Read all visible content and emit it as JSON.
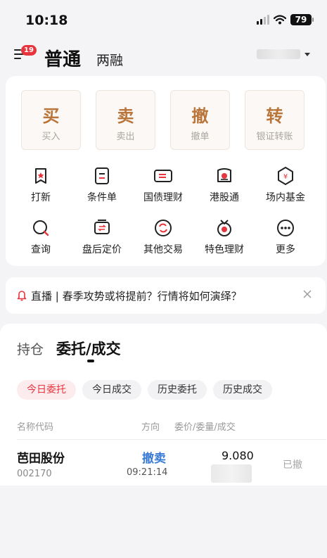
{
  "status_bar": {
    "time": "10:18",
    "battery": "79"
  },
  "header": {
    "badge_count": "19",
    "tab_normal": "普通",
    "tab_margin": "两融"
  },
  "trade_buttons": [
    {
      "main": "买",
      "sub": "买入"
    },
    {
      "main": "卖",
      "sub": "卖出"
    },
    {
      "main": "撤",
      "sub": "撤单"
    },
    {
      "main": "转",
      "sub": "银证转账"
    }
  ],
  "functions": [
    {
      "label": "打新",
      "icon": "ipo-flag-icon"
    },
    {
      "label": "条件单",
      "icon": "condition-order-icon"
    },
    {
      "label": "国债理财",
      "icon": "treasury-bond-icon"
    },
    {
      "label": "港股通",
      "icon": "hk-connect-icon"
    },
    {
      "label": "场内基金",
      "icon": "exchange-fund-icon"
    },
    {
      "label": "查询",
      "icon": "query-icon"
    },
    {
      "label": "盘后定价",
      "icon": "after-hours-pricing-icon"
    },
    {
      "label": "其他交易",
      "icon": "other-trade-icon"
    },
    {
      "label": "特色理财",
      "icon": "featured-finance-icon"
    },
    {
      "label": "更多",
      "icon": "more-icon"
    }
  ],
  "broadcast": {
    "text": "直播 | 春季攻势或将提前？行情将如何演绎？"
  },
  "orders": {
    "tab_hold": "持仓",
    "tab_orders": "委托/成交",
    "chips": [
      "今日委托",
      "今日成交",
      "历史委托",
      "历史成交"
    ],
    "columns": {
      "name": "名称代码",
      "direction": "方向",
      "price_qty": "委价/委量/成交"
    },
    "rows": [
      {
        "name": "芭田股份",
        "code": "002170",
        "direction": "撤卖",
        "time": "09:21:14",
        "price": "9.080",
        "status": "已撤"
      }
    ]
  },
  "colors": {
    "accent_red": "#e8343c",
    "trade_gold": "#b9753a",
    "sell_blue": "#3a7bd5"
  }
}
